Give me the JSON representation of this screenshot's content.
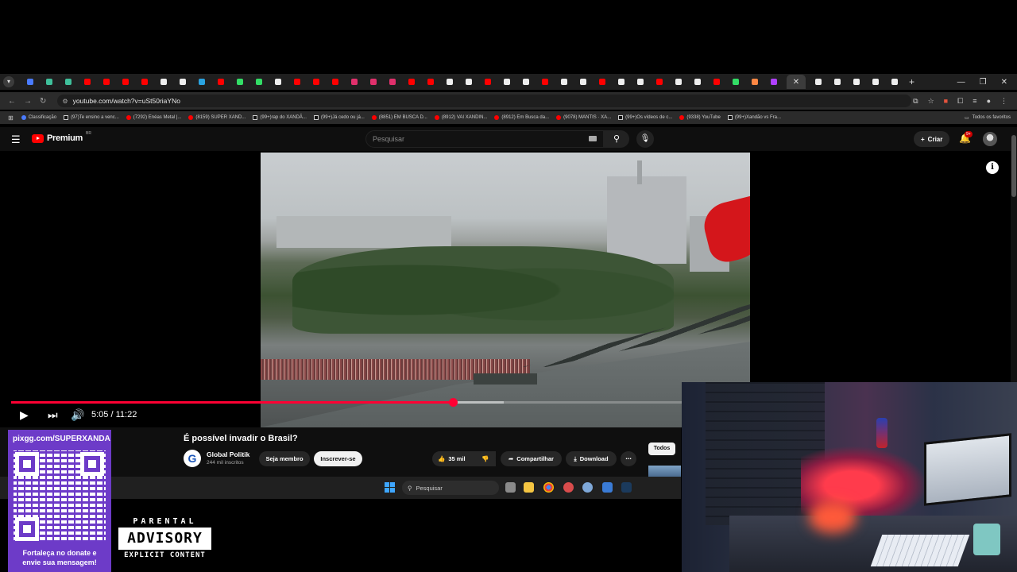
{
  "browser": {
    "url": "youtube.com/watch?v=uSt50riaYNo",
    "bookmarks": [
      {
        "label": "Classificação",
        "icon": "blue"
      },
      {
        "label": "(97)Te ensino a venc...",
        "icon": "tiktok"
      },
      {
        "label": "(7292) Enéas Metal |...",
        "icon": "youtube"
      },
      {
        "label": "(8159) SUPER XAND...",
        "icon": "youtube"
      },
      {
        "label": "(99+)rap do XANDÃ...",
        "icon": "tiktok"
      },
      {
        "label": "(99+)Já cedo ou já...",
        "icon": "tiktok"
      },
      {
        "label": "(8851) EM BUSCA D...",
        "icon": "youtube"
      },
      {
        "label": "(8912) VAI XANDIN...",
        "icon": "youtube"
      },
      {
        "label": "(8912) Em Busca da...",
        "icon": "youtube"
      },
      {
        "label": "(9078) MANTIS · XA...",
        "icon": "youtube"
      },
      {
        "label": "(99+)Os vídeos de c...",
        "icon": "tiktok"
      },
      {
        "label": "(9338) YouTube",
        "icon": "youtube"
      },
      {
        "label": "(99+)Xandão vs Fra...",
        "icon": "tiktok"
      }
    ],
    "all_bookmarks_label": "Todos os favoritos"
  },
  "youtube": {
    "logo_text": "Premium",
    "region": "BR",
    "search_placeholder": "Pesquisar",
    "create_label": "Criar",
    "notifications_badge": "9+"
  },
  "player": {
    "current_time": "5:05",
    "separator": "/",
    "duration": "11:22",
    "progress_fraction": 0.447,
    "info_label": "i"
  },
  "video": {
    "title": "É possível invadir o Brasil?",
    "channel_name": "Global Politik",
    "channel_initial": "G",
    "subscribers": "244 mil inscritos",
    "member_label": "Seja membro",
    "subscribe_label": "Inscrever-se",
    "likes": "35 mil",
    "share_label": "Compartilhar",
    "download_label": "Download",
    "more_label": "⋯",
    "chip_all": "Todos"
  },
  "taskbar": {
    "search_placeholder": "Pesquisar"
  },
  "overlay": {
    "donate_url": "pixgg.com/SUPERXANDA",
    "donate_message_line1": "Fortaleça no donate e",
    "donate_message_line2": "envie sua mensagem!",
    "advisory_top": "PARENTAL",
    "advisory_mid": "ADVISORY",
    "advisory_bot": "EXPLICIT CONTENT"
  },
  "colors": {
    "yt_red": "#ff0000",
    "progress_red": "#ff0033",
    "donate_purple": "#6d3bc8"
  }
}
